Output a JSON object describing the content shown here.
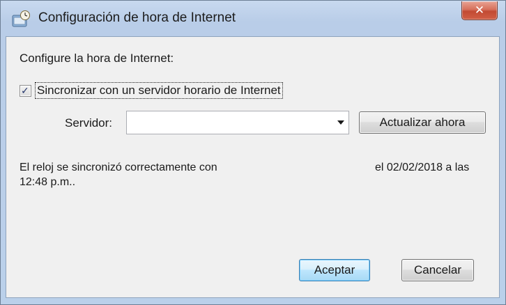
{
  "window": {
    "title": "Configuración de hora de Internet",
    "title_icon": "clock-globe-icon",
    "close_icon": "close-icon",
    "close_glyph": "✕"
  },
  "dialog": {
    "heading": "Configure la hora de Internet:",
    "sync_checkbox": {
      "label": "Sincronizar con un servidor horario de Internet",
      "checked": true,
      "check_glyph": "✓"
    },
    "server": {
      "label": "Servidor:",
      "value": "",
      "update_button": "Actualizar ahora"
    },
    "status": {
      "line1": "El reloj se sincronizó correctamente con",
      "date": "el 02/02/2018 a las",
      "line2": "12:48 p.m.."
    },
    "buttons": {
      "accept": "Aceptar",
      "cancel": "Cancelar"
    }
  },
  "colors": {
    "titlebar": "#bad0ea",
    "close_button": "#c24a33",
    "client_bg": "#f0f0f0",
    "default_button_border": "#3c7fb1"
  }
}
